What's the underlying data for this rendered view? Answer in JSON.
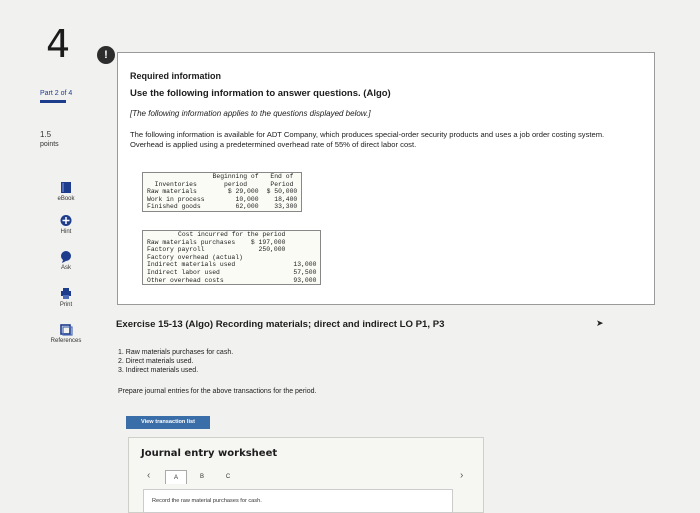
{
  "sidebar": {
    "question_number": "4",
    "part": "Part 2 of 4",
    "points_value": "1.5",
    "points_label": "points",
    "tools": [
      {
        "label": "eBook"
      },
      {
        "label": "Hint"
      },
      {
        "label": "Ask"
      },
      {
        "label": "Print"
      },
      {
        "label": "References"
      }
    ]
  },
  "info": {
    "badge": "!",
    "title": "Required information",
    "heading": "Use the following information to answer questions. (Algo)",
    "note": "[The following information applies to the questions displayed below.]",
    "description": "The following information is available for ADT Company, which produces special-order security products and uses a job order costing system. Overhead is applied using a predetermined overhead rate of 55% of direct labor cost.",
    "inventory_table": {
      "headers": [
        "Inventories",
        "Beginning of period",
        "End of Period"
      ],
      "header_lines": [
        [
          "",
          "Beginning of",
          "End of"
        ],
        [
          "Inventories",
          "period",
          "Period"
        ]
      ],
      "rows": [
        [
          "Raw materials",
          "$ 29,000",
          "$ 50,000"
        ],
        [
          "Work in process",
          "10,000",
          "18,400"
        ],
        [
          "Finished goods",
          "62,000",
          "33,300"
        ]
      ]
    },
    "cost_table": {
      "title": "Cost incurred for the period",
      "rows": [
        [
          "Raw materials purchases",
          "$ 197,000",
          ""
        ],
        [
          "Factory payroll",
          "250,000",
          ""
        ],
        [
          "Factory overhead (actual)",
          "",
          ""
        ],
        [
          "Indirect materials used",
          "",
          "13,000"
        ],
        [
          "Indirect labor used",
          "",
          "57,500"
        ],
        [
          "Other overhead costs",
          "",
          "93,000"
        ]
      ]
    }
  },
  "exercise": {
    "title": "Exercise 15-13 (Algo) Recording materials; direct and indirect LO P1, P3",
    "tasks": [
      "1. Raw materials purchases for cash.",
      "2. Direct materials used.",
      "3. Indirect materials used."
    ],
    "prepare": "Prepare journal entries for the above transactions for the period.",
    "view_button": "View transaction list"
  },
  "worksheet": {
    "title": "Journal entry worksheet",
    "tabs": [
      "A",
      "B",
      "C"
    ],
    "active_tab": "A",
    "instruction": "Record the raw material purchases for cash."
  },
  "colors": {
    "accent": "#1e3c8c",
    "button": "#3a6ea8",
    "badge": "#2d2d2d"
  }
}
